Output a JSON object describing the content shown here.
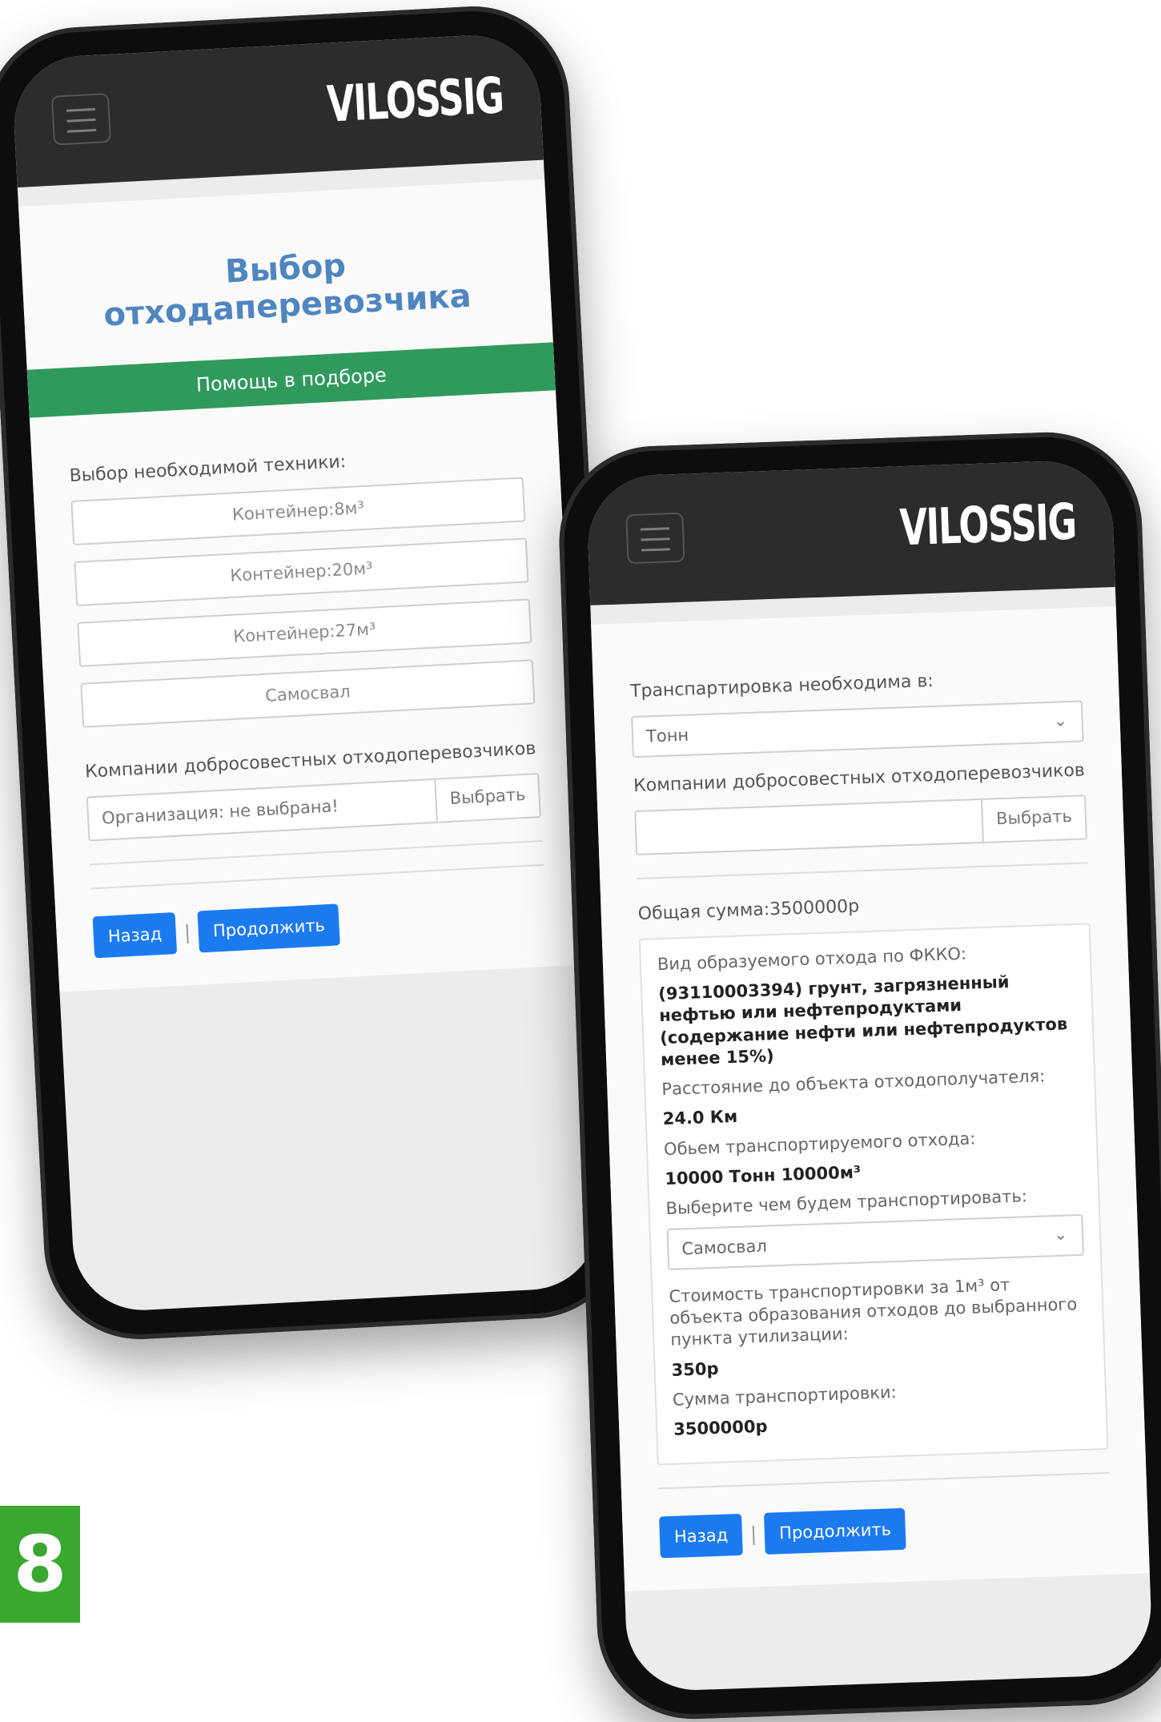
{
  "brand": "VILOSSIG",
  "phone1": {
    "title": "Выбор отходаперевозчика",
    "help_button": "Помощь в подборе",
    "equipment_label": "Выбор необходимой техники:",
    "equipment_options": [
      "Контейнер:8м³",
      "Контейнер:20м³",
      "Контейнер:27м³",
      "Самосвал"
    ],
    "companies_label": "Компании добросовестных отходоперевозчиков",
    "org_placeholder": "Организация: не выбрана!",
    "select_button": "Выбрать",
    "back_button": "Назад",
    "continue_button": "Продолжить",
    "separator": "|"
  },
  "phone2": {
    "transport_label": "Транспартировка необходима в:",
    "unit_select": "Тонн",
    "companies_label": "Компании добросовестных отходоперевозчиков",
    "select_button": "Выбрать",
    "total": "Общая сумма:3500000р",
    "waste_type_label": "Вид образуемого отхода по ФККО:",
    "waste_type_value": "(93110003394) грунт, загрязненный нефтью или нефтепродуктами (содержание нефти или нефтепродуктов менее 15%)",
    "distance_label": "Расстояние до объекта отходополучателя:",
    "distance_value": "24.0 Км",
    "volume_label": "Обьем транспортируемого отхода:",
    "volume_value": "10000 Тонн 10000м³",
    "vehicle_label": "Выберите чем будем транспортировать:",
    "vehicle_select": "Самосвал",
    "cost_label": "Стоимость транспортировки за 1м³ от объекта образования отходов до выбранного пункта утилизации:",
    "cost_value": "350р",
    "sum_label": "Сумма транспортировки:",
    "sum_value": "3500000р",
    "back_button": "Назад",
    "continue_button": "Продолжить",
    "separator": "|"
  },
  "badge": "8",
  "icons": {
    "menu": "hamburger-icon",
    "chevron": "chevron-down-icon"
  },
  "colors": {
    "accent": "#1b7af0",
    "green": "#2f9a5c",
    "title": "#4f86c0",
    "header": "#2c2c2e",
    "badge": "#3aa82f"
  }
}
